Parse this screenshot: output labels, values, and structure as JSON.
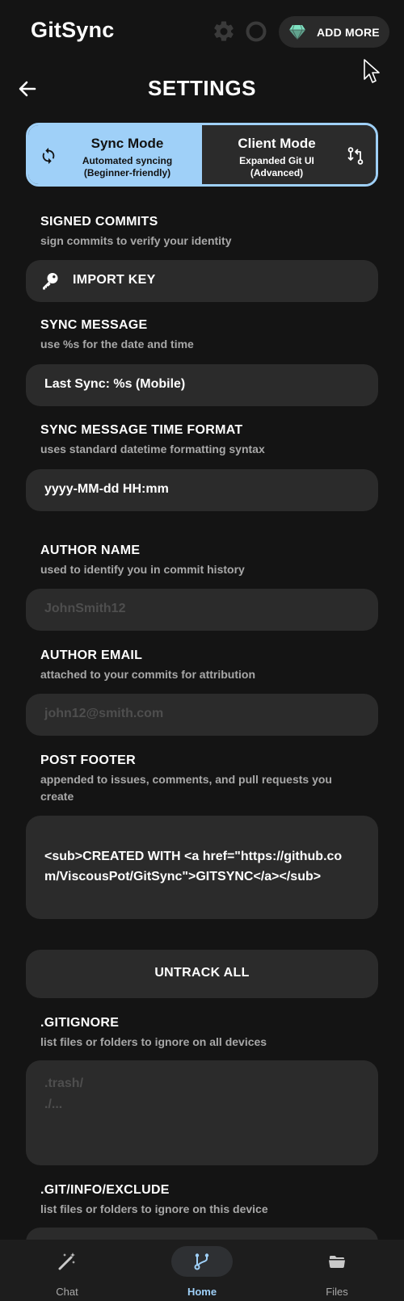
{
  "app": {
    "title": "GitSync"
  },
  "topbar": {
    "add_more_label": "ADD MORE"
  },
  "header": {
    "title": "SETTINGS"
  },
  "mode_toggle": {
    "sync": {
      "title": "Sync Mode",
      "line1": "Automated syncing",
      "line2": "(Beginner-friendly)",
      "selected": true
    },
    "client": {
      "title": "Client Mode",
      "line1": "Expanded Git UI",
      "line2": "(Advanced)",
      "selected": false
    }
  },
  "signed_commits": {
    "title": "SIGNED COMMITS",
    "subtitle": "sign commits to verify your identity",
    "button_label": "IMPORT KEY"
  },
  "sync_message": {
    "title": "SYNC MESSAGE",
    "subtitle": "use %s for the date and time",
    "value": "Last Sync: %s (Mobile)"
  },
  "sync_time_format": {
    "title": "SYNC MESSAGE TIME FORMAT",
    "subtitle": "uses standard datetime formatting syntax",
    "value": "yyyy-MM-dd HH:mm"
  },
  "author_name": {
    "title": "AUTHOR NAME",
    "subtitle": "used to identify you in commit history",
    "placeholder": "JohnSmith12"
  },
  "author_email": {
    "title": "AUTHOR EMAIL",
    "subtitle": "attached to your commits for attribution",
    "placeholder": "john12@smith.com"
  },
  "post_footer": {
    "title": "POST FOOTER",
    "subtitle": "appended to issues, comments, and pull requests you create",
    "value": "<sub>CREATED WITH <a href=\"https://github.com/ViscousPot/GitSync\">GITSYNC</a></sub>"
  },
  "untrack_all": {
    "label": "UNTRACK ALL"
  },
  "gitignore": {
    "title": ".GITIGNORE",
    "subtitle": "list files or folders to ignore on all devices",
    "placeholder": ".trash/\n./..."
  },
  "git_info_exclude": {
    "title": ".GIT/INFO/EXCLUDE",
    "subtitle": "list files or folders to ignore on this device"
  },
  "bottom_nav": {
    "items": [
      {
        "label": "Chat",
        "icon": "magic-wand-icon",
        "active": false
      },
      {
        "label": "Home",
        "icon": "branch-icon",
        "active": true
      },
      {
        "label": "Files",
        "icon": "folder-icon",
        "active": false
      }
    ]
  },
  "colors": {
    "accent": "#9fd0f8",
    "background": "#141414",
    "surface": "#2b2b2b",
    "gem": "#7fe3c3"
  }
}
